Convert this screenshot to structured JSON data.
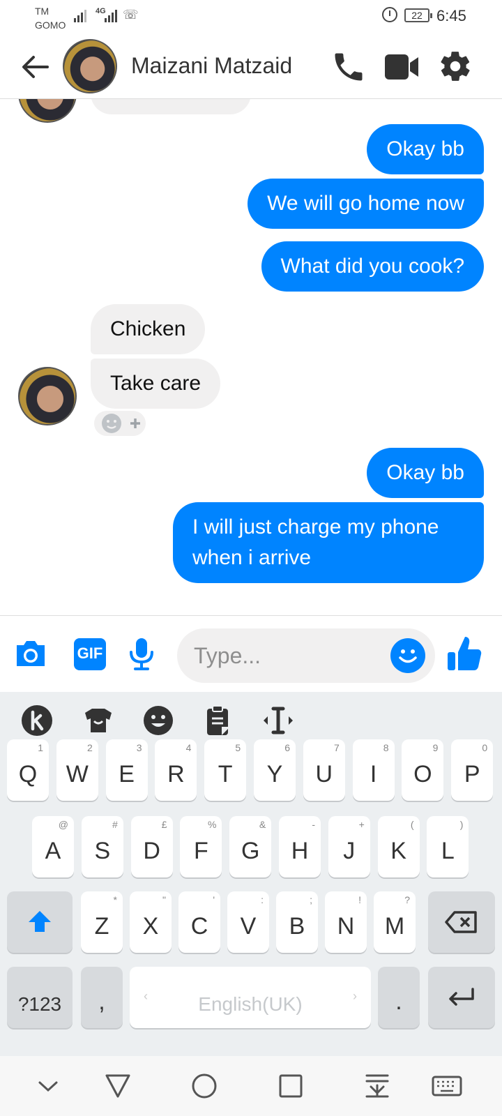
{
  "status_bar": {
    "carrier_line1": "TM",
    "carrier_line2": "GOMO",
    "network": "4G",
    "battery": "22",
    "time": "6:45"
  },
  "header": {
    "contact_name": "Maizani Matzaid",
    "icons": [
      "back-arrow-icon",
      "phone-icon",
      "video-camera-icon",
      "gear-icon"
    ],
    "accent_color": "#0084ff"
  },
  "messages": [
    {
      "from": "me",
      "text": "Okay bb"
    },
    {
      "from": "me",
      "text": "We will go home now"
    },
    {
      "from": "me",
      "text": "What did you cook?"
    },
    {
      "from": "them",
      "text": "Chicken"
    },
    {
      "from": "them",
      "text": "Take care"
    },
    {
      "from": "me",
      "text": "Okay bb"
    },
    {
      "from": "me",
      "text": "I will just charge my phone when i arrive"
    }
  ],
  "composer": {
    "placeholder": "Type...",
    "gif_label": "GIF",
    "icons": [
      "camera-icon",
      "gif-icon",
      "microphone-icon",
      "emoji-icon",
      "thumbs-up-icon"
    ]
  },
  "keyboard": {
    "toolbar_icons": [
      "kika-logo-icon",
      "theme-shirt-icon",
      "emoji-face-icon",
      "clipboard-icon",
      "text-cursor-icon"
    ],
    "row1": [
      {
        "key": "Q",
        "hint": "1"
      },
      {
        "key": "W",
        "hint": "2"
      },
      {
        "key": "E",
        "hint": "3"
      },
      {
        "key": "R",
        "hint": "4"
      },
      {
        "key": "T",
        "hint": "5"
      },
      {
        "key": "Y",
        "hint": "6"
      },
      {
        "key": "U",
        "hint": "7"
      },
      {
        "key": "I",
        "hint": "8"
      },
      {
        "key": "O",
        "hint": "9"
      },
      {
        "key": "P",
        "hint": "0"
      }
    ],
    "row2": [
      {
        "key": "A",
        "hint": "@"
      },
      {
        "key": "S",
        "hint": "#"
      },
      {
        "key": "D",
        "hint": "£"
      },
      {
        "key": "F",
        "hint": "%"
      },
      {
        "key": "G",
        "hint": "&"
      },
      {
        "key": "H",
        "hint": "-"
      },
      {
        "key": "J",
        "hint": "+"
      },
      {
        "key": "K",
        "hint": "("
      },
      {
        "key": "L",
        "hint": ")"
      }
    ],
    "row3": [
      {
        "key": "Z",
        "hint": "*"
      },
      {
        "key": "X",
        "hint": "\""
      },
      {
        "key": "C",
        "hint": "'"
      },
      {
        "key": "V",
        "hint": ":"
      },
      {
        "key": "B",
        "hint": ";"
      },
      {
        "key": "N",
        "hint": "!"
      },
      {
        "key": "M",
        "hint": "?"
      }
    ],
    "symbols_key": "?123",
    "comma_key": ",",
    "space_label": "English(UK)",
    "period_key": "."
  },
  "nav_bar": {
    "icons": [
      "chevron-down-icon",
      "back-triangle-icon",
      "home-circle-icon",
      "recents-square-icon",
      "notification-pull-icon",
      "keyboard-icon"
    ]
  }
}
